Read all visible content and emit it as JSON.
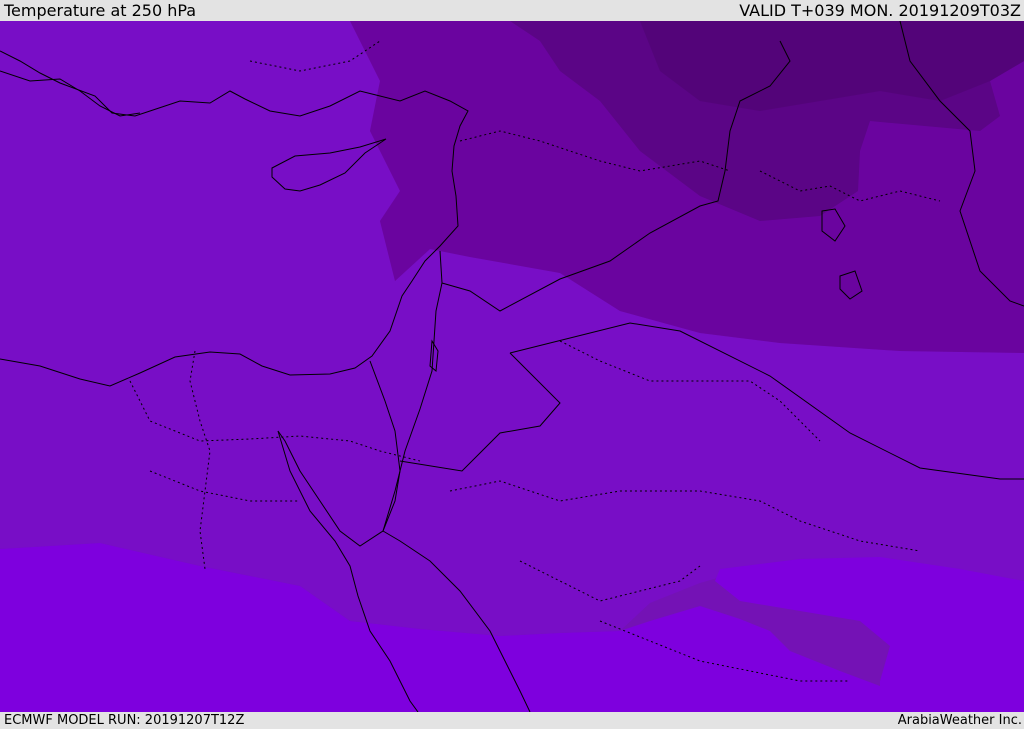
{
  "header": {
    "title": "Temperature at 250 hPa",
    "valid": "VALID T+039 MON. 20191209T03Z"
  },
  "footer": {
    "model_run": "ECMWF MODEL RUN: 20191207T12Z",
    "credit": "ArabiaWeather Inc."
  },
  "colors": {
    "band_warmest": "#7e00de",
    "band_warm": "#780ec6",
    "band_mid": "#7412b5",
    "band_cool": "#6a049f",
    "band_cold": "#5b0586",
    "band_coldest": "#530479",
    "land_border": "#000000"
  }
}
